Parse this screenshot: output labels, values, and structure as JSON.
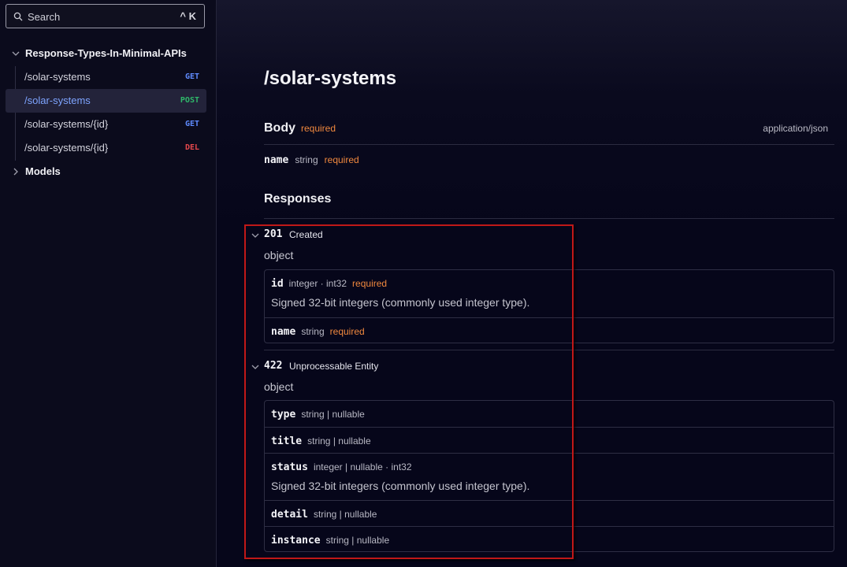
{
  "search": {
    "placeholder": "Search",
    "shortcut": "^ K"
  },
  "sidebar": {
    "root_label": "Response-Types-In-Minimal-APIs",
    "items": [
      {
        "path": "/solar-systems",
        "method": "GET",
        "method_color": "#5f8bff",
        "active": false
      },
      {
        "path": "/solar-systems",
        "method": "POST",
        "method_color": "#2fb86a",
        "active": true
      },
      {
        "path": "/solar-systems/{id}",
        "method": "GET",
        "method_color": "#5f8bff",
        "active": false
      },
      {
        "path": "/solar-systems/{id}",
        "method": "DEL",
        "method_color": "#e5484d",
        "active": false
      }
    ],
    "models_label": "Models"
  },
  "main": {
    "title": "/solar-systems",
    "body": {
      "heading": "Body",
      "required": "required",
      "content_type": "application/json",
      "field": {
        "name": "name",
        "type": "string",
        "required": "required"
      }
    },
    "responses_heading": "Responses",
    "responses": [
      {
        "code": "201",
        "desc": "Created",
        "object_label": "object",
        "props": [
          {
            "name": "id",
            "type": "integer · int32",
            "required": "required",
            "desc": "Signed 32-bit integers (commonly used integer type)."
          },
          {
            "name": "name",
            "type": "string",
            "required": "required"
          }
        ]
      },
      {
        "code": "422",
        "desc": "Unprocessable Entity",
        "object_label": "object",
        "props": [
          {
            "name": "type",
            "type": "string | nullable"
          },
          {
            "name": "title",
            "type": "string | nullable"
          },
          {
            "name": "status",
            "type": "integer | nullable · int32",
            "desc": "Signed 32-bit integers (commonly used integer type)."
          },
          {
            "name": "detail",
            "type": "string | nullable"
          },
          {
            "name": "instance",
            "type": "string | nullable"
          }
        ]
      }
    ]
  },
  "colors": {
    "required": "#f0883e",
    "highlight": "#c01818"
  }
}
